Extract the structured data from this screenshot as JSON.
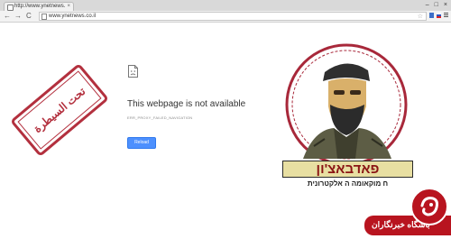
{
  "browser": {
    "tab_title": "http://www.ynetnews.co",
    "tab_close": "×",
    "window_buttons": [
      "–",
      "□",
      "×"
    ],
    "nav": {
      "back": "←",
      "forward": "→",
      "reload": "C"
    },
    "url": "www.ynetnews.co.il",
    "star": "☆"
  },
  "error_page": {
    "title": "This webpage is not available",
    "error_code": "ERR_PROXY_FAILED_NAVIGATION",
    "reload_button": "Reload"
  },
  "overlay": {
    "stamp_text": "تحت السيطرة",
    "banner_title": "פאדבאצ'ון",
    "banner_subtitle": "ח מוקאומה ה אלקטרונית",
    "agency_name": "باشگاه خبرنگاران",
    "colors": {
      "stamp": "#b3303e",
      "banner_bg": "#e8dfa2",
      "banner_text": "#8a1414",
      "agency": "#b8141f"
    }
  }
}
